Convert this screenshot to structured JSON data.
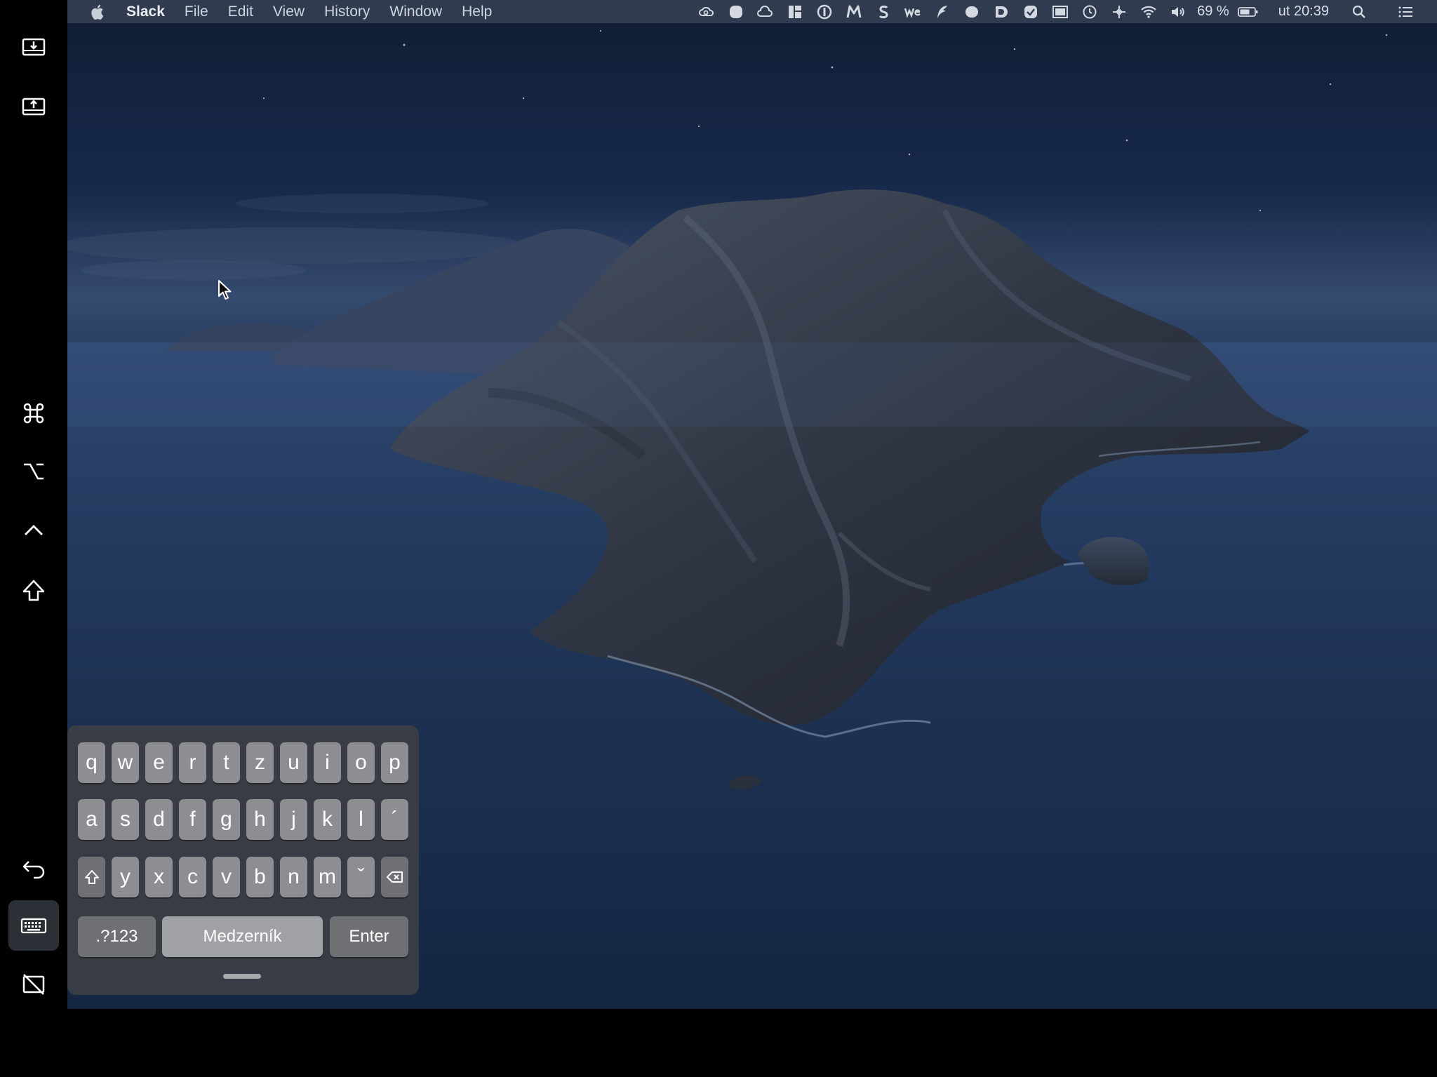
{
  "menubar": {
    "app_name": "Slack",
    "menus": [
      "File",
      "Edit",
      "View",
      "History",
      "Window",
      "Help"
    ],
    "battery": "69 %",
    "clock": "ut 20:39",
    "tray_icons": [
      "creative-cloud-icon",
      "record-icon",
      "heart-cloud-icon",
      "grid-app-icon",
      "one-password-icon",
      "m-app-icon",
      "s-app-icon",
      "we-app-icon",
      "flux-icon",
      "circle-app-icon",
      "d-app-icon",
      "check-app-icon",
      "window-app-icon",
      "time-machine-icon",
      "move-icon",
      "wifi-icon",
      "volume-icon",
      "battery-icon",
      "spotlight-icon",
      "notification-center-icon"
    ]
  },
  "sidebar": {
    "items": [
      "download-screen-icon",
      "upload-screen-icon",
      "command-key-icon",
      "option-key-icon",
      "control-key-icon",
      "shift-key-icon",
      "undo-icon",
      "keyboard-icon",
      "disconnect-display-icon"
    ]
  },
  "keyboard": {
    "row1": [
      "q",
      "w",
      "e",
      "r",
      "t",
      "z",
      "u",
      "i",
      "o",
      "p"
    ],
    "row2": [
      "a",
      "s",
      "d",
      "f",
      "g",
      "h",
      "j",
      "k",
      "l",
      "´"
    ],
    "row3": [
      "y",
      "x",
      "c",
      "v",
      "b",
      "n",
      "m",
      "ˇ"
    ],
    "numbers_label": ".?123",
    "space_label": "Medzerník",
    "enter_label": "Enter"
  },
  "colors": {
    "menubar": "#343e52",
    "key": "#8d8e91",
    "keyboard_bg": "#3c3e44",
    "sidebar": "#000000"
  }
}
